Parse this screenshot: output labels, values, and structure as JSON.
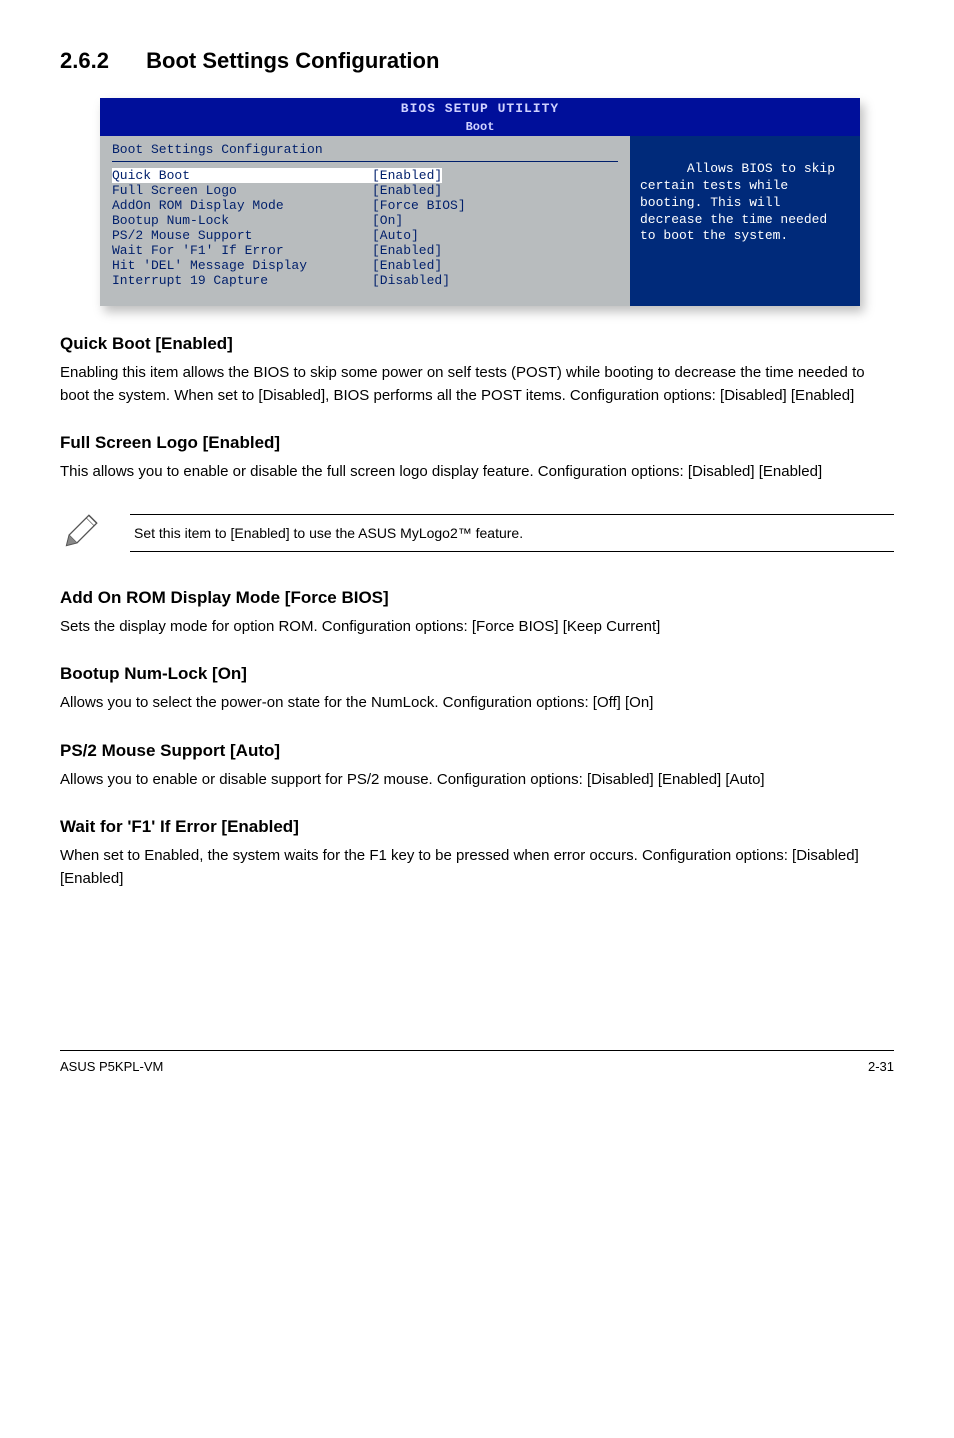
{
  "section": {
    "number": "2.6.2",
    "title": "Boot Settings Configuration"
  },
  "bios": {
    "title_top": "BIOS SETUP UTILITY",
    "title_sub": "Boot",
    "config_heading": "Boot Settings Configuration",
    "rows": [
      {
        "label": "Quick Boot",
        "value": "[Enabled]",
        "hl": true
      },
      {
        "label": "Full Screen Logo",
        "value": "[Enabled]",
        "hl": false
      },
      {
        "label": "AddOn ROM Display Mode",
        "value": "[Force BIOS]",
        "hl": false
      },
      {
        "label": "Bootup Num-Lock",
        "value": "[On]",
        "hl": false
      },
      {
        "label": "PS/2 Mouse Support",
        "value": "[Auto]",
        "hl": false
      },
      {
        "label": "Wait For 'F1' If Error",
        "value": "[Enabled]",
        "hl": false
      },
      {
        "label": "Hit 'DEL' Message Display",
        "value": "[Enabled]",
        "hl": false
      },
      {
        "label": "Interrupt 19 Capture",
        "value": "[Disabled]",
        "hl": false
      }
    ],
    "help_text": "Allows BIOS to skip certain tests while booting. This will decrease the time needed to boot the system."
  },
  "quick_boot": {
    "heading": "Quick Boot [Enabled]",
    "body": "Enabling this item allows the BIOS to skip some power on self tests (POST) while booting to decrease the time needed to boot the system. When set to [Disabled], BIOS performs all the POST items. Configuration options: [Disabled] [Enabled]"
  },
  "full_screen_logo": {
    "heading": "Full Screen Logo [Enabled]",
    "body": "This allows you to enable or disable the full screen logo display feature. Configuration options: [Disabled] [Enabled]"
  },
  "note": {
    "text": "Set this item to [Enabled] to use the ASUS MyLogo2™ feature."
  },
  "addon_rom": {
    "heading": "Add On ROM Display Mode [Force BIOS]",
    "body": "Sets the display mode for option ROM. Configuration options: [Force BIOS] [Keep Current]"
  },
  "numlock": {
    "heading": "Bootup Num-Lock [On]",
    "body": "Allows you to select the power-on state for the NumLock. Configuration options: [Off] [On]"
  },
  "ps2": {
    "heading": "PS/2 Mouse Support [Auto]",
    "body": "Allows you to enable or disable support for PS/2 mouse. Configuration options: [Disabled] [Enabled] [Auto]"
  },
  "waitf1": {
    "heading": "Wait for 'F1' If Error [Enabled]",
    "body": "When set to Enabled, the system waits for the F1 key to be pressed when error occurs. Configuration options: [Disabled] [Enabled]"
  },
  "footer": {
    "left": "ASUS P5KPL-VM",
    "right": "2-31"
  }
}
